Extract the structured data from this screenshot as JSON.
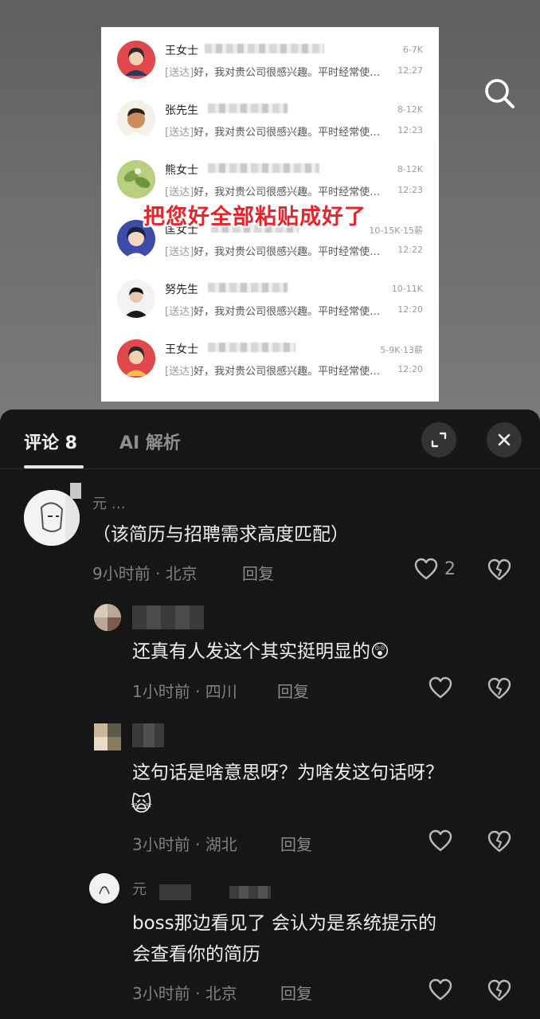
{
  "video": {
    "search_icon": "search-icon",
    "caption": "把您好全部粘贴成好了",
    "chats": [
      {
        "name": "王女士",
        "salary": "6-7K",
        "tag": "[送达]",
        "message": "好，我对贵公司很感兴趣。平时经常使…",
        "time": "12:27"
      },
      {
        "name": "张先生",
        "salary": "8-12K",
        "tag": "[送达]",
        "message": "好，我对贵公司很感兴趣。平时经常使…",
        "time": "12:23"
      },
      {
        "name": "熊女士",
        "salary": "8-12K",
        "tag": "[送达]",
        "message": "好，我对贵公司很感兴趣。平时经常使…",
        "time": "12:23"
      },
      {
        "name": "匡女士",
        "salary": "10-15K·15薪",
        "tag": "[送达]",
        "message": "好，我对贵公司很感兴趣。平时经常使…",
        "time": "12:22"
      },
      {
        "name": "努先生",
        "salary": "10-11K",
        "tag": "[送达]",
        "message": "好，我对贵公司很感兴趣。平时经常使…",
        "time": "12:20"
      },
      {
        "name": "王女士",
        "salary": "5-9K·13薪",
        "tag": "[送达]",
        "message": "好，我对贵公司很感兴趣。平时经常使…",
        "time": "12:20"
      }
    ]
  },
  "header": {
    "tabs": [
      {
        "label": "评论 8",
        "active": true
      },
      {
        "label": "AI 解析",
        "active": false
      }
    ],
    "expand_icon": "expand-icon",
    "close_icon": "close-icon"
  },
  "comments": [
    {
      "name": "元 …",
      "text": "（该简历与招聘需求高度匹配）",
      "meta": "9小时前 · 北京",
      "reply": "回复",
      "likes": "2"
    },
    {
      "name": "",
      "text": "还真有人发这个其实挺明显的",
      "emoji": "😲",
      "meta": "1小时前 · 四川",
      "reply": "回复",
      "likes": ""
    },
    {
      "name": "",
      "text": "这句话是啥意思呀？为啥发这句话呀？",
      "emoji": "🙀",
      "meta": "3小时前 · 湖北",
      "reply": "回复",
      "likes": ""
    },
    {
      "name": "元",
      "text_line1": "boss那边看见了 会认为是系统提示的",
      "text_line2": "会查看你的简历",
      "meta": "3小时前 · 北京",
      "reply": "回复",
      "likes": ""
    }
  ],
  "colors": {
    "caption_red": "#e8232a",
    "sheet_bg": "#161616",
    "button_bg": "#333333"
  }
}
